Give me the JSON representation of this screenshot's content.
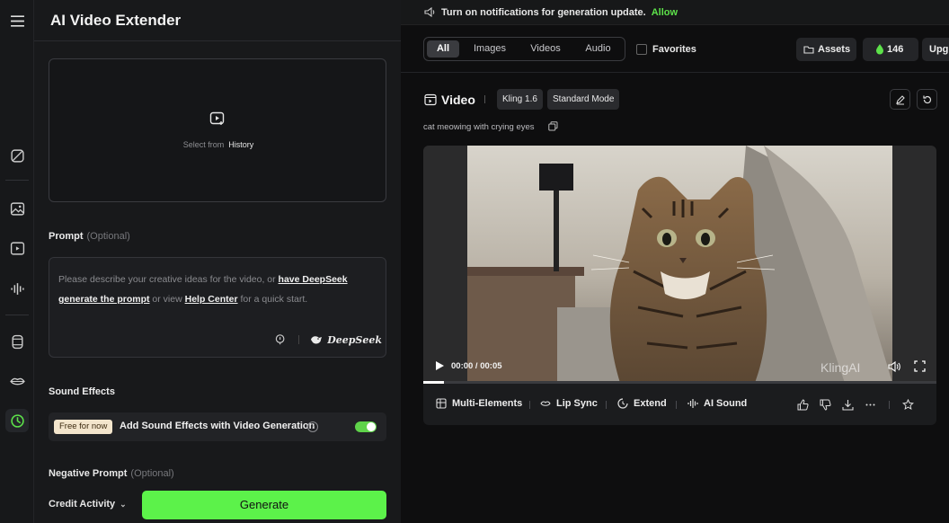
{
  "rail": {
    "items": [
      {
        "name": "menu-icon"
      },
      {
        "name": "magic-tool-icon"
      },
      {
        "name": "image-gen-icon"
      },
      {
        "name": "video-gen-icon"
      },
      {
        "name": "audio-gen-icon"
      },
      {
        "name": "effects-icon"
      },
      {
        "name": "lip-sync-icon"
      },
      {
        "name": "video-extender-icon"
      }
    ],
    "accent": "#5de24a"
  },
  "panel": {
    "title": "AI Video Extender",
    "upload": {
      "prefix": "Select from",
      "link": "History"
    },
    "prompt": {
      "label": "Prompt",
      "optional": "(Optional)",
      "placeholder_a": "Please describe your creative ideas for the video, or ",
      "link_deepseek": "have DeepSeek generate the prompt",
      "placeholder_b": " or view ",
      "link_help": "Help Center",
      "placeholder_c": " for a quick start.",
      "deepseek_brand": "DeepSeek"
    },
    "sound": {
      "label": "Sound Effects",
      "badge": "Free for now",
      "text": "Add Sound Effects with Video Generation",
      "help": "?",
      "enabled": true
    },
    "negative": {
      "label": "Negative Prompt",
      "optional": "(Optional)"
    },
    "footer": {
      "credit": "Credit Activity",
      "chevron": "⌄",
      "generate": "Generate"
    }
  },
  "notification": {
    "text": "Turn on notifications for generation update.",
    "allow": "Allow"
  },
  "filters": {
    "tabs": [
      "All",
      "Images",
      "Videos",
      "Audio"
    ],
    "active": "All",
    "favorites": "Favorites",
    "assets": "Assets",
    "credits": "146",
    "upgrade": "Upg"
  },
  "card": {
    "title": "Video",
    "model": "Kling 1.6",
    "mode": "Standard Mode",
    "caption": "cat meowing with crying eyes",
    "player": {
      "time": "00:00 / 00:05",
      "watermark": "KlingAI",
      "progress": 0.04
    },
    "actions": [
      "Multi-Elements",
      "Lip Sync",
      "Extend",
      "AI Sound"
    ]
  },
  "colors": {
    "generate_green": "#5cf24a",
    "badge_bg": "#f3e5cc",
    "allow_green": "#5de24a"
  }
}
